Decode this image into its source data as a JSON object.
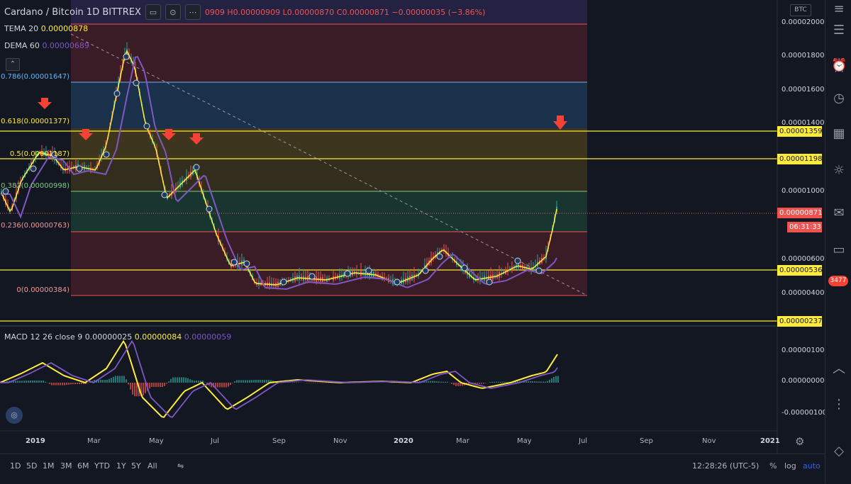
{
  "legend": {
    "symbol": "Cardano / Bitcoin  1D  BITTREX",
    "ohlc": "0909  H0.00000909  L0.00000870  C0.00000871  −0.00000035 (−3.86%)"
  },
  "indicators": {
    "tema": {
      "label": "TEMA 20",
      "value": "0.00000878"
    },
    "dema": {
      "label": "DEMA 60",
      "value": "0.00000689"
    },
    "macd": {
      "label": "MACD 12 26 close 9",
      "v1": "0.00000025",
      "v2": "0.00000084",
      "v3": "0.00000059"
    }
  },
  "fib_labels": [
    {
      "text": "0.786(0.00001647)",
      "color": "#64b5f6"
    },
    {
      "text": "0.618(0.00001377)",
      "color": "#ffeb3b"
    },
    {
      "text": "0.5(0.00001187)",
      "color": "#ffeb3b"
    },
    {
      "text": "0.382(0.00000998)",
      "color": "#81c784"
    },
    {
      "text": "0.236(0.00000763)",
      "color": "#ef9a9a"
    },
    {
      "text": "0(0.00000384)",
      "color": "#ef9a9a"
    }
  ],
  "price_axis": {
    "currency": "BTC",
    "ticks": [
      "0.00002000",
      "0.00001800",
      "0.00001600",
      "0.00001400",
      "0.00001000",
      "0.00000600",
      "0.00000400"
    ],
    "yellow_tags": [
      "0.00001359",
      "0.00001198",
      "0.00000536",
      "0.00000237"
    ],
    "current_price": "0.00000871",
    "countdown": "06:31:33",
    "macd_ticks": [
      "0.00000100",
      "0.00000000",
      "-0.00000100"
    ]
  },
  "time_axis": [
    "2019",
    "Mar",
    "May",
    "Jul",
    "Sep",
    "Nov",
    "2020",
    "Mar",
    "May",
    "Jul",
    "Sep",
    "Nov",
    "2021"
  ],
  "bottom": {
    "ranges": [
      "1D",
      "5D",
      "1M",
      "3M",
      "6M",
      "YTD",
      "1Y",
      "5Y",
      "All"
    ],
    "clock": "12:28:26 (UTC-5)",
    "percent": "%",
    "log": "log",
    "auto": "auto"
  },
  "right_badge": "3477",
  "colors": {
    "bg": "#131722",
    "tema": "#ffeb3b",
    "dema": "#7e57c2",
    "up": "#26a69a",
    "down": "#ef5350"
  }
}
